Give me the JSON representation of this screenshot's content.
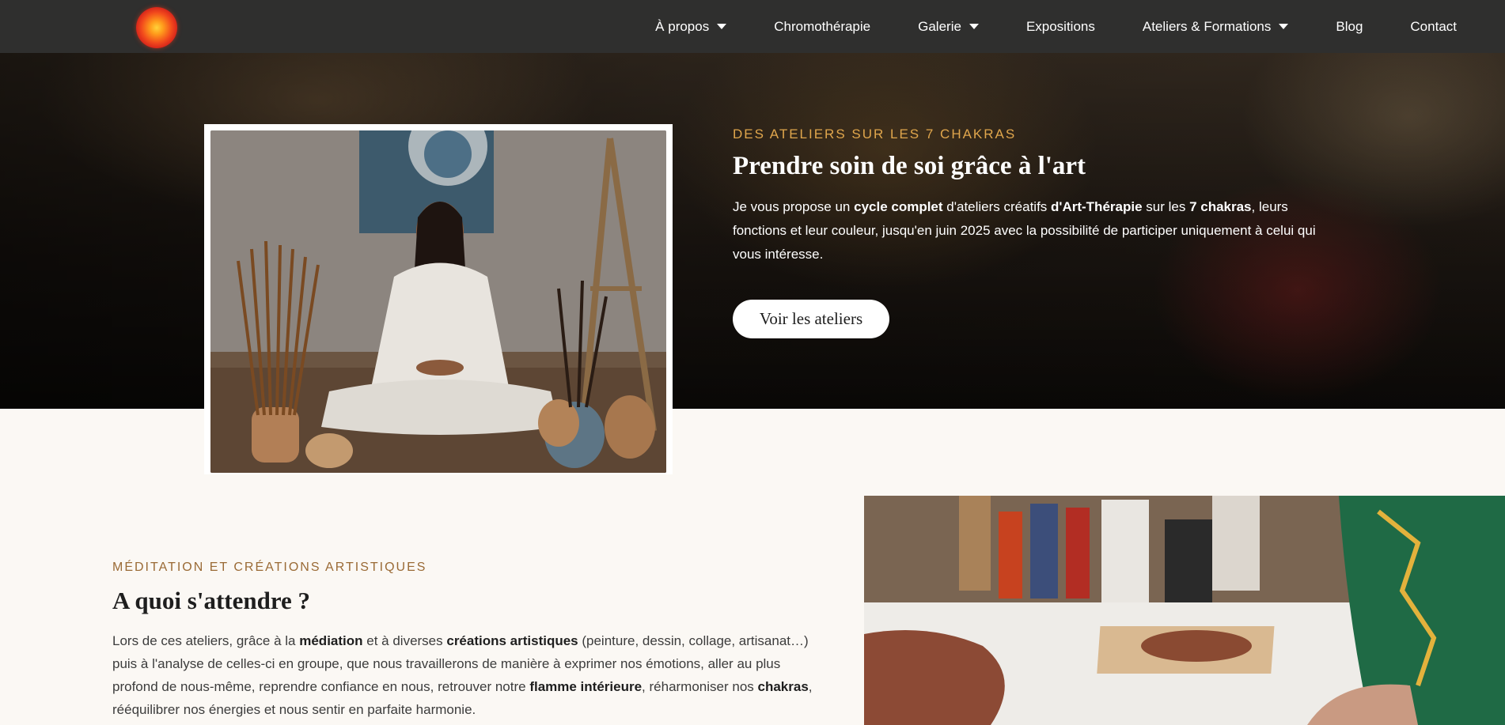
{
  "nav": {
    "items": [
      {
        "label": "À propos",
        "dropdown": true
      },
      {
        "label": "Chromothérapie",
        "dropdown": false
      },
      {
        "label": "Galerie",
        "dropdown": true
      },
      {
        "label": "Expositions",
        "dropdown": false
      },
      {
        "label": "Ateliers & Formations",
        "dropdown": true
      },
      {
        "label": "Blog",
        "dropdown": false
      },
      {
        "label": "Contact",
        "dropdown": false
      }
    ]
  },
  "hero": {
    "eyebrow": "DES ATELIERS SUR LES 7 CHAKRAS",
    "title": "Prendre soin de soi grâce à l'art",
    "text": {
      "p1": "Je vous propose un ",
      "b1": "cycle complet",
      "p2": " d'ateliers créatifs ",
      "b2": "d'Art-Thérapie",
      "p3": " sur les ",
      "b3": "7 chakras",
      "p4": ", leurs fonctions et leur couleur, jusqu'en juin 2025 avec la possibilité de participer uniquement à celui qui vous intéresse."
    },
    "button": "Voir les ateliers"
  },
  "section2": {
    "eyebrow": "MÉDITATION ET CRÉATIONS ARTISTIQUES",
    "title": "A quoi s'attendre ?",
    "text": {
      "p1": "Lors de ces ateliers, grâce à la ",
      "b1": "médiation",
      "p2": " et à diverses ",
      "b2": "créations artistiques",
      "p3": " (peinture, dessin, collage, artisanat…) puis à l'analyse de celles-ci en groupe, que nous travaillerons de manière à exprimer nos émotions, aller au plus profond de nous-même, reprendre confiance en nous, retrouver notre ",
      "b3": "flamme intérieure",
      "p4": ", réharmoniser nos ",
      "b4": "chakras",
      "p5": ", rééquilibrer nos énergies et nous sentir en parfaite harmonie."
    }
  },
  "colors": {
    "nav_bg": "#2f2f2e",
    "accent_gold": "#e0a64c",
    "accent_brown": "#9a6a35",
    "page_bg": "#fbf8f4"
  },
  "icons": {
    "logo": "logo-sun-icon",
    "dropdown": "caret-down-icon"
  }
}
